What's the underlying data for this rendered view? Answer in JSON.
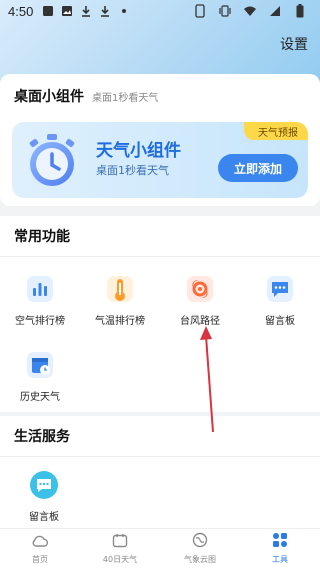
{
  "status_bar": {
    "time": "4:50"
  },
  "header": {
    "settings_label": "设置"
  },
  "widget_section": {
    "title": "桌面小组件",
    "subtitle": "桌面1秒看天气",
    "banner": {
      "tag": "天气预报",
      "title": "天气小组件",
      "subtitle": "桌面1秒看天气",
      "button_label": "立即添加"
    }
  },
  "common_section": {
    "title": "常用功能",
    "items": [
      {
        "label": "空气排行榜",
        "icon": "air-ranking-icon"
      },
      {
        "label": "气温排行榜",
        "icon": "thermometer-icon"
      },
      {
        "label": "台风路径",
        "icon": "typhoon-icon"
      },
      {
        "label": "留言板",
        "icon": "message-board-icon"
      },
      {
        "label": "历史天气",
        "icon": "history-weather-icon"
      }
    ]
  },
  "life_section": {
    "title": "生活服务",
    "items": [
      {
        "label": "留言板",
        "icon": "message-board-icon"
      }
    ]
  },
  "tabbar": {
    "items": [
      {
        "label": "首页",
        "icon": "cloud-icon",
        "active": false
      },
      {
        "label": "40日天气",
        "icon": "calendar-icon",
        "active": false
      },
      {
        "label": "气象云图",
        "icon": "globe-icon",
        "active": false
      },
      {
        "label": "工具",
        "icon": "tools-icon",
        "active": true
      }
    ]
  },
  "colors": {
    "accent": "#2b7ae6",
    "banner_button": "#3a86ee",
    "tag": "#ffd84a",
    "arrow": "#d9333f"
  }
}
